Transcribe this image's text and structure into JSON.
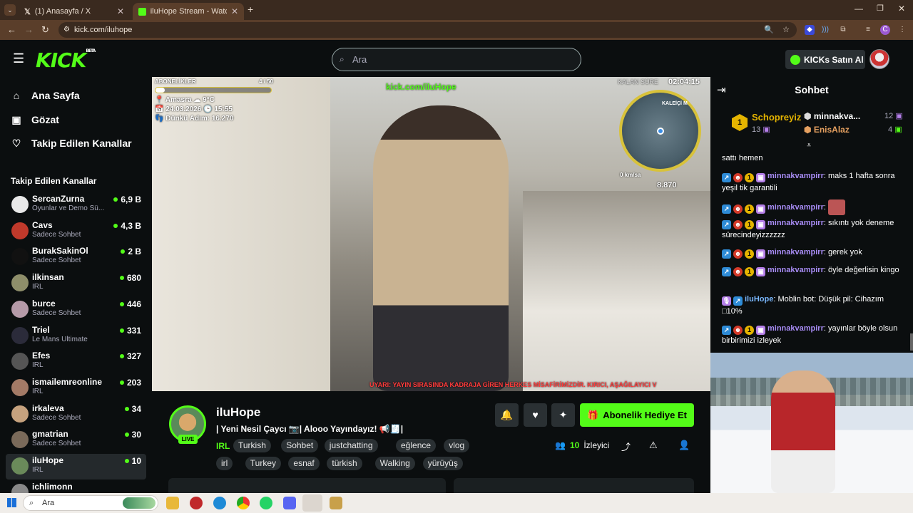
{
  "browser": {
    "tabs": [
      {
        "label": "(1) Anasayfa / X",
        "active": false
      },
      {
        "label": "iluHope Stream - Watch Li",
        "active": true
      }
    ],
    "url": "kick.com/iluhope"
  },
  "header": {
    "logo": "KICK",
    "logo_sup": "BETA",
    "search_placeholder": "Ara",
    "kicks_button": "KICKs Satın Al"
  },
  "sidebar": {
    "nav": [
      {
        "label": "Ana Sayfa",
        "icon": "home-icon"
      },
      {
        "label": "Gözat",
        "icon": "browse-icon"
      },
      {
        "label": "Takip Edilen Kanallar",
        "icon": "heart-icon"
      }
    ],
    "followed_title": "Takip Edilen Kanallar",
    "channels": [
      {
        "name": "SercanZurna",
        "category": "Oyunlar ve Demo Sü...",
        "viewers": "6,9 B",
        "color": "#e9e9e9"
      },
      {
        "name": "Cavs",
        "category": "Sadece Sohbet",
        "viewers": "4,3 B",
        "color": "#c0392b"
      },
      {
        "name": "BurakSakinOl",
        "category": "Sadece Sohbet",
        "viewers": "2 B",
        "color": "#111111"
      },
      {
        "name": "ilkinsan",
        "category": "IRL",
        "viewers": "680",
        "color": "#8e8e6a"
      },
      {
        "name": "burce",
        "category": "Sadece Sohbet",
        "viewers": "446",
        "color": "#b59aa8"
      },
      {
        "name": "Triel",
        "category": "Le Mans Ultimate",
        "viewers": "331",
        "color": "#2b2b3a"
      },
      {
        "name": "Efes",
        "category": "IRL",
        "viewers": "327",
        "color": "#555555"
      },
      {
        "name": "ismailemreonline",
        "category": "IRL",
        "viewers": "203",
        "color": "#a37a66"
      },
      {
        "name": "irkaleva",
        "category": "Sadece Sohbet",
        "viewers": "34",
        "color": "#c6a27e"
      },
      {
        "name": "gmatrian",
        "category": "Sadece Sohbet",
        "viewers": "30",
        "color": "#7a6a5a"
      },
      {
        "name": "iluHope",
        "category": "IRL",
        "viewers": "10",
        "color": "#6a8a5a"
      },
      {
        "name": "ichlimonn",
        "category": "",
        "viewers": "",
        "color": "#888888"
      }
    ]
  },
  "video": {
    "overlay": {
      "subs_label": "ABONELİKLER",
      "subs_count": "4 / 50",
      "subs_progress": 0.08,
      "location": "Amasra",
      "weather": "9°C",
      "date": "24.03.2026",
      "time": "15:55",
      "steps": "Dünkü Adım: 16.270",
      "url_text": "kick.com/iluHope",
      "timer_label": "KALAN SÜRE",
      "timer": "02:04:15",
      "speed": "0 km/sa",
      "hp": "8.870",
      "map_label": "KALEİÇİ M",
      "warning": "UYARI: YAYIN SIRASINDA KADRAJA GİREN HERKES MİSAFİRİMİZDİR. KIRICI, AŞAĞILAYICI V"
    }
  },
  "stream": {
    "name": "iluHope",
    "live": "LIVE",
    "title": "| Yeni Nesil Çaycı 📷| Alooo Yayındayız! 📢🧾|",
    "category": "IRL",
    "tags_row1": [
      "Turkish",
      "Sohbet",
      "justchatting",
      "eğlence",
      "vlog"
    ],
    "tags_row2": [
      "irl",
      "Turkey",
      "esnaf",
      "türkish",
      "Walking",
      "yürüyüş"
    ],
    "gift_button": "Abonelik Hediye Et",
    "viewers_count": "10",
    "viewers_label": "İzleyici"
  },
  "chat": {
    "title": "Sohbet",
    "leaderboard": [
      {
        "rank": "1",
        "name": "Schopreyiz",
        "count": "13"
      },
      {
        "name": "minnakva...",
        "count": "12"
      },
      {
        "name": "EnisAlaz",
        "count": "4"
      }
    ],
    "messages": [
      {
        "user": "",
        "text": "sattı hemen"
      },
      {
        "user": "minnakvampirr",
        "text": "maks 1 hafta sonra yeşil tik garantili"
      },
      {
        "user": "minnakvampirr",
        "text": ""
      },
      {
        "user": "minnakvampirr",
        "text": "sıkıntı yok deneme sürecindeyizzzzzz"
      },
      {
        "user": "minnakvampirr",
        "text": "gerek yok"
      },
      {
        "user": "minnakvampirr",
        "text": "öyle değerlisin kingo"
      },
      {
        "user": "iluHope",
        "text": "Moblin bot: Düşük pil: Cihazım □10%"
      },
      {
        "user": "minnakvampirr",
        "text": "yayınlar böyle olsun birbirimizi izleyek"
      }
    ]
  },
  "taskbar": {
    "search_placeholder": "Ara"
  },
  "colors": {
    "accent": "#53fc18",
    "background": "#0b0e0f",
    "button_bg": "#2a3033",
    "chat_user": "#a88cf5"
  }
}
